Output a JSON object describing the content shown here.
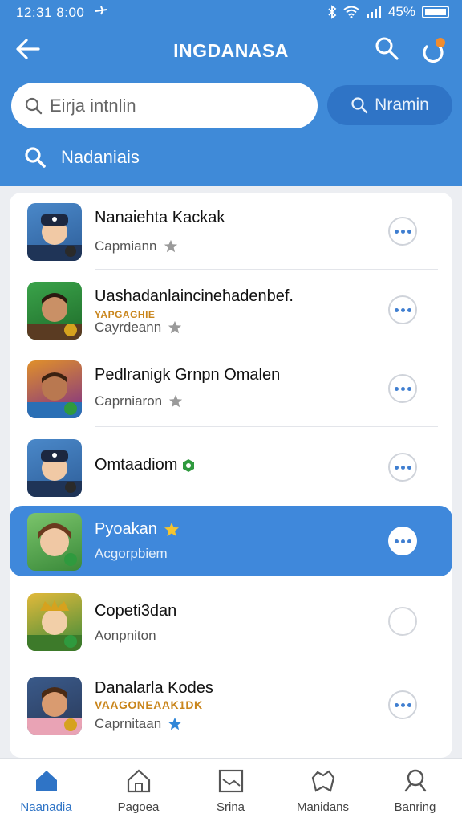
{
  "status_bar": {
    "time": "12:31 8:00",
    "battery": "45%"
  },
  "appbar": {
    "title": "INGDANASA"
  },
  "search": {
    "placeholder": "Eirja intnlin",
    "action_label": "Nramin",
    "sub_label": "Nadaniais"
  },
  "items": [
    {
      "name": "Nanaiehta Kackak",
      "tag": "",
      "sub": "Capmiann",
      "star": "grey",
      "action": "more"
    },
    {
      "name": "Uashadanlaincineħadenbef.",
      "tag": "YAPGAGHIE",
      "sub": "Cayrdeann",
      "star": "grey",
      "action": "more"
    },
    {
      "name": "Pedlranigk Grnpn Omalen",
      "tag": "",
      "sub": "Caprniaron",
      "star": "grey",
      "action": "more"
    },
    {
      "name": "Omtaadiom",
      "tag": "",
      "sub": "",
      "star": "",
      "action": "more"
    },
    {
      "name": "Pyoakan",
      "tag": "",
      "sub": "Acgorpbiem",
      "star": "gold",
      "action": "more"
    },
    {
      "name": "Copeti3dan",
      "tag": "",
      "sub": "Aonpniton",
      "star": "",
      "action": "radio"
    },
    {
      "name": "Danalarla Kodes",
      "tag": "VAAGONEAAK1DK",
      "sub": "Caprnitaan",
      "star": "blue",
      "action": "more"
    }
  ],
  "tabs": [
    {
      "label": "Naanadia",
      "icon": "home-icon"
    },
    {
      "label": "Pagoea",
      "icon": "house-outline-icon"
    },
    {
      "label": "Srina",
      "icon": "chart-icon"
    },
    {
      "label": "Manidans",
      "icon": "group-icon"
    },
    {
      "label": "Banring",
      "icon": "profile-icon"
    }
  ],
  "colors": {
    "header": "#3f8ad8",
    "active_row": "#3f88db",
    "accent_dot": "#f08c2e"
  }
}
